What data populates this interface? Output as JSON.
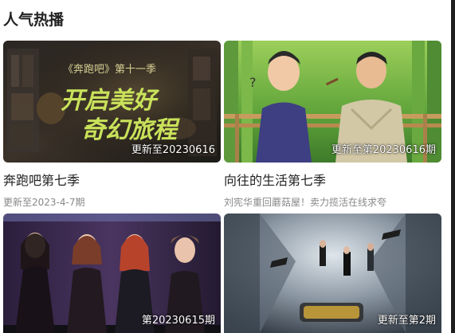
{
  "section": {
    "title": "人气热播"
  },
  "cards": [
    {
      "title": "奔跑吧第七季",
      "subtitle": "更新至2023-4-7期",
      "badge": "更新至20230616",
      "poster_text": {
        "season": "《奔跑吧》第十一季",
        "line1": "开启美好",
        "line2": "奇幻旅程"
      }
    },
    {
      "title": "向往的生活第七季",
      "subtitle": "刘宪华重回蘑菇屋！卖力揽活在线求夸",
      "badge": "更新至第20230616期"
    },
    {
      "badge": "第20230615期"
    },
    {
      "badge": "更新至第2期"
    }
  ],
  "colors": {
    "title_text": "#222222",
    "subtitle_text": "#888888",
    "badge_text": "#ffffff",
    "poster1_text": "#c9e25a"
  }
}
